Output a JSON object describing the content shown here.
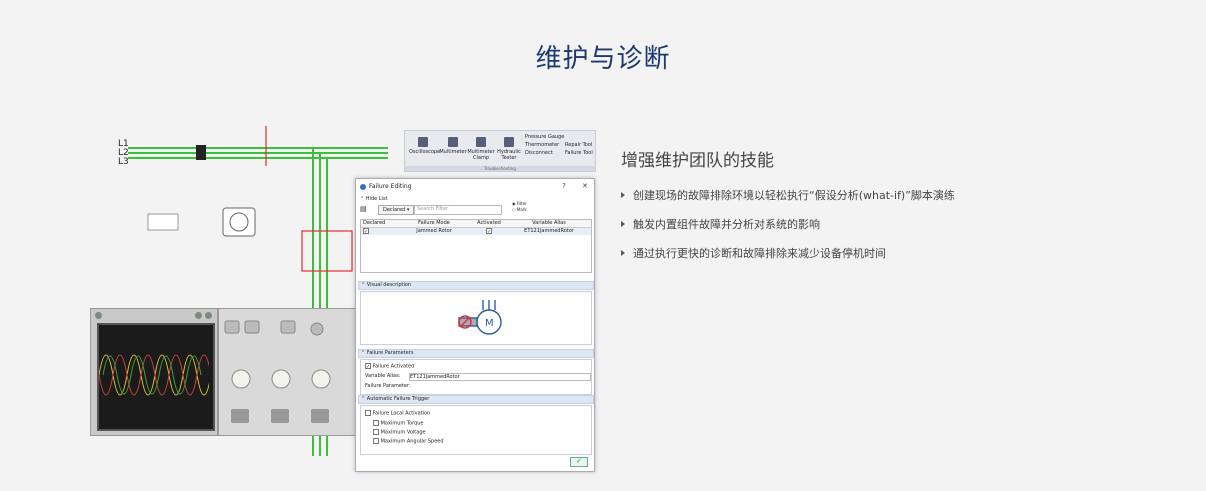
{
  "page": {
    "title": "维护与诊断"
  },
  "info": {
    "subtitle": "增强维护团队的技能",
    "bullets": [
      "创建现场的故障排除环境以轻松执行“假设分析(what-if)”脚本演练",
      "触发内置组件故障并分析对系统的影响",
      "通过执行更快的诊断和故障排除来减少设备停机时间"
    ]
  },
  "ribbon": {
    "oscilloscope": "Oscilloscope",
    "multimeter": "Multimeter",
    "multimeter_clamp": "Multimeter Clamp",
    "hydraulic_tester": "Hydraulic Tester",
    "pressure_gauge": "Pressure Gauge",
    "thermometer": "Thermometer",
    "disconnect": "Disconnect",
    "repair_tool": "Repair Tool",
    "failure_tool": "Failure Tool",
    "group_label": "Troubleshooting"
  },
  "schematic": {
    "line_labels": [
      "L1",
      "L2",
      "L3"
    ]
  },
  "dialog": {
    "title": "Failure Editing",
    "help": "?",
    "close": "✕",
    "hide_list": "Hide List",
    "declared_button": "Declared",
    "filter_placeholder": "Search Filter",
    "radio_filter": "Filter",
    "radio_mark": "Mark",
    "columns": [
      "Declared",
      "Failure Mode",
      "Activated",
      "Variable Alias"
    ],
    "rows": [
      {
        "declared": true,
        "mode": "Jammed Rotor",
        "activated": true,
        "alias": "ET121JammedRotor"
      }
    ],
    "visual_description": "Visual description",
    "motor_label": "M",
    "failure_parameters": "Failure Parameters",
    "failure_activated": "Failure Activated",
    "variable_alias_label": "Variable Alias:",
    "variable_alias_value": "ET121JammedRotor",
    "failure_parameter_label": "Failure Parameter:",
    "automatic_trigger": "Automatic Failure Trigger",
    "local_activation": "Failure Local Activation",
    "max_torque": "Maximum Torque",
    "max_voltage": "Maximum Voltage",
    "max_speed": "Maximum Angular Speed",
    "ok": "✓"
  },
  "colors": {
    "title": "#1c3a6e",
    "wire_green": "#3cc03c",
    "wire_red": "#e03030",
    "accent_blue": "#3a6fc4",
    "background": "#f3f3f3"
  },
  "icons": {
    "bullet": "triangle-right-icon",
    "motor": "motor-icon"
  }
}
